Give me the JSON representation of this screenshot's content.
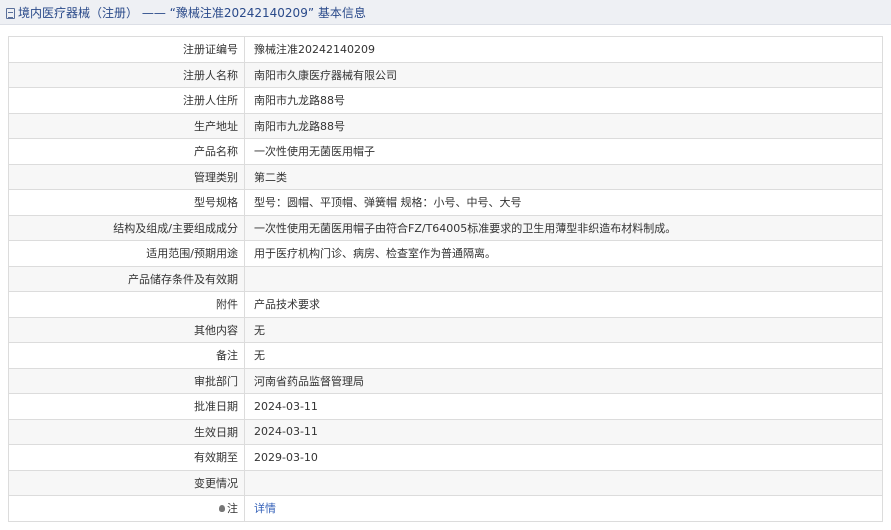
{
  "header": {
    "icon": "document-icon",
    "text": "境内医疗器械（注册） —— “豫械注准20242140209” 基本信息"
  },
  "rows": [
    {
      "label": "注册证编号",
      "value": "豫械注准20242140209"
    },
    {
      "label": "注册人名称",
      "value": "南阳市久康医疗器械有限公司"
    },
    {
      "label": "注册人住所",
      "value": "南阳市九龙路88号"
    },
    {
      "label": "生产地址",
      "value": "南阳市九龙路88号"
    },
    {
      "label": "产品名称",
      "value": "一次性使用无菌医用帽子"
    },
    {
      "label": "管理类别",
      "value": "第二类"
    },
    {
      "label": "型号规格",
      "value": "型号：圆帽、平顶帽、弹簧帽 规格：小号、中号、大号"
    },
    {
      "label": "结构及组成/主要组成成分",
      "value": "一次性使用无菌医用帽子由符合FZ/T64005标准要求的卫生用薄型非织造布材料制成。"
    },
    {
      "label": "适用范围/预期用途",
      "value": "用于医疗机构门诊、病房、检查室作为普通隔离。"
    },
    {
      "label": "产品储存条件及有效期",
      "value": ""
    },
    {
      "label": "附件",
      "value": "产品技术要求"
    },
    {
      "label": "其他内容",
      "value": "无"
    },
    {
      "label": "备注",
      "value": "无"
    },
    {
      "label": "审批部门",
      "value": "河南省药品监督管理局"
    },
    {
      "label": "批准日期",
      "value": "2024-03-11"
    },
    {
      "label": "生效日期",
      "value": "2024-03-11"
    },
    {
      "label": "有效期至",
      "value": "2029-03-10"
    },
    {
      "label": "变更情况",
      "value": ""
    }
  ],
  "note_row": {
    "icon": "lightbulb-icon",
    "label": "注",
    "link": "详情"
  },
  "colors": {
    "header_bg": "#eef0f4",
    "header_text": "#2a4a8a",
    "border": "#dcdcdc",
    "link": "#3360b8",
    "row_alt_bg": "#f7f7f7"
  }
}
